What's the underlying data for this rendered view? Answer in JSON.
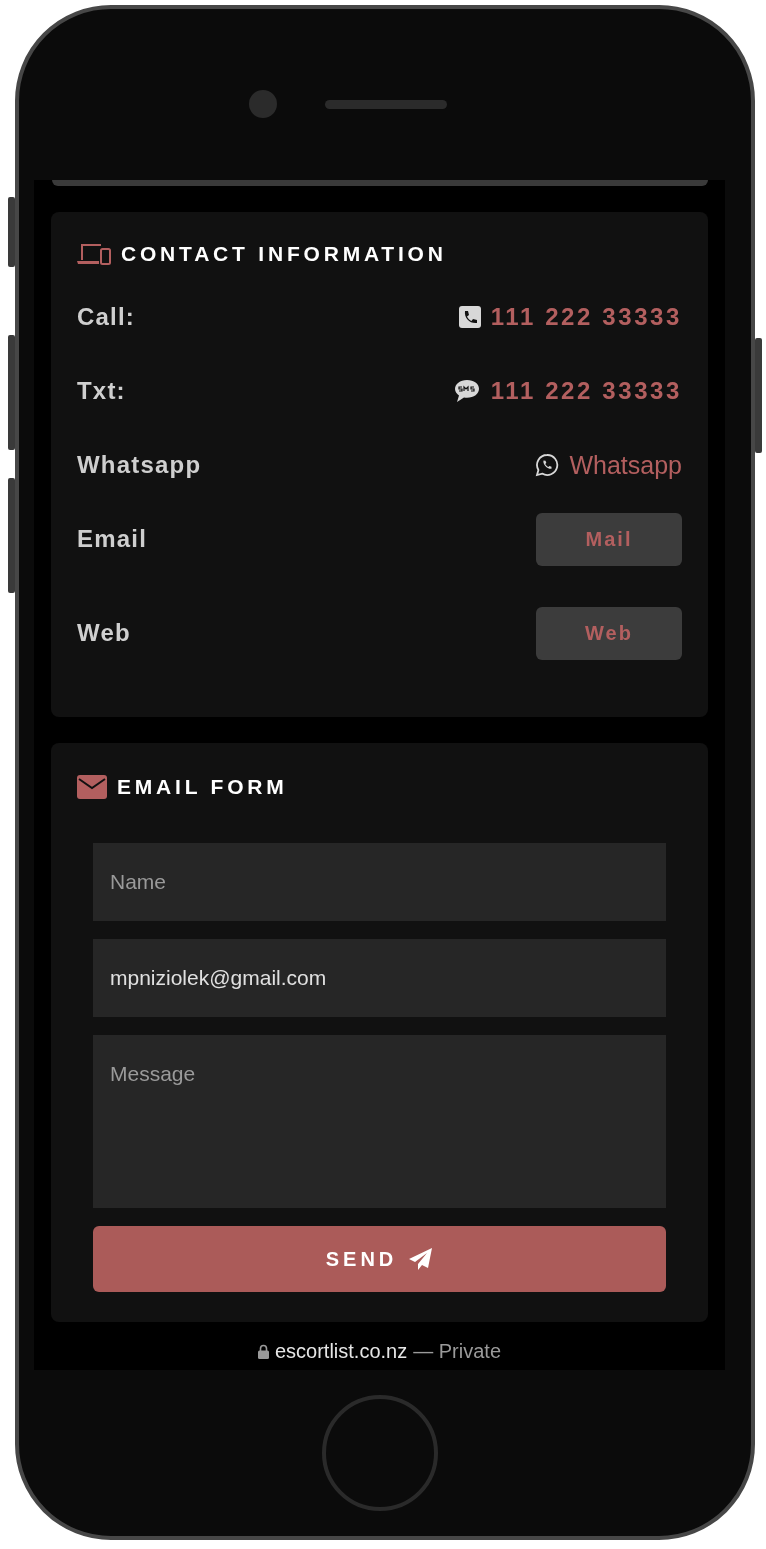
{
  "contact": {
    "title": "CONTACT INFORMATION",
    "rows": [
      {
        "kind": "phone",
        "label": "Call:",
        "value": "111 222 33333"
      },
      {
        "kind": "sms",
        "label": "Txt:",
        "value": "111 222 33333"
      },
      {
        "kind": "whatsapp",
        "label": "Whatsapp",
        "value": "Whatsapp"
      },
      {
        "kind": "button",
        "label": "Email",
        "value": "Mail"
      },
      {
        "kind": "button",
        "label": "Web",
        "value": "Web"
      }
    ]
  },
  "email_form": {
    "title": "EMAIL FORM",
    "fields": [
      {
        "kind": "input",
        "placeholder": "Name"
      },
      {
        "kind": "input",
        "value": "mpniziolek@gmail.com"
      },
      {
        "kind": "textarea",
        "placeholder": "Message"
      }
    ],
    "submit": "SEND"
  },
  "browser_bar": {
    "url": "escortlist.co.nz",
    "mode": "— Private"
  }
}
